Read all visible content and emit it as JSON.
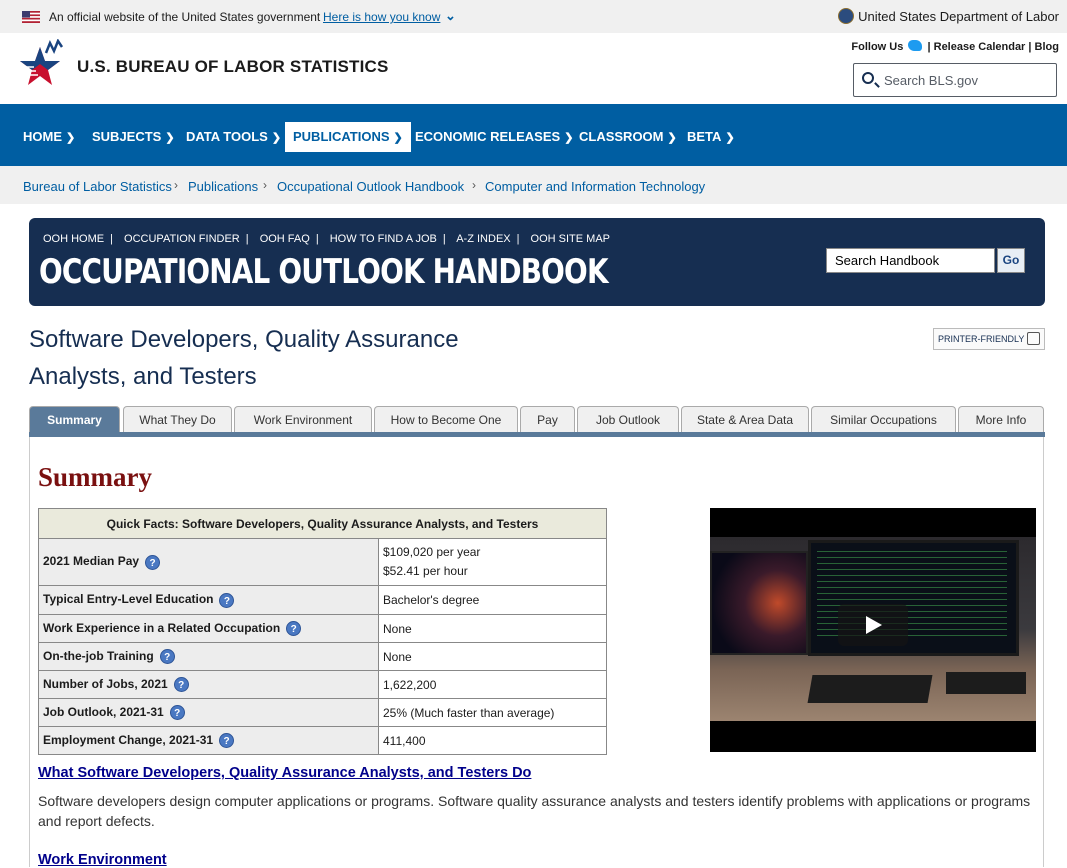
{
  "govbar": {
    "official_text": "An official website of the United States government",
    "how_link": "Here is how you know",
    "dol": "United States Department of Labor"
  },
  "header": {
    "agency": "U.S. BUREAU OF LABOR STATISTICS",
    "follow_us": "Follow Us",
    "release_calendar": "Release Calendar",
    "blog": "Blog",
    "search_placeholder": "Search BLS.gov"
  },
  "nav": {
    "items": [
      {
        "label": "HOME"
      },
      {
        "label": "SUBJECTS"
      },
      {
        "label": "DATA TOOLS"
      },
      {
        "label": "PUBLICATIONS"
      },
      {
        "label": "ECONOMIC RELEASES"
      },
      {
        "label": "CLASSROOM"
      },
      {
        "label": "BETA"
      }
    ],
    "active": "PUBLICATIONS"
  },
  "breadcrumb": [
    "Bureau of Labor Statistics",
    "Publications",
    "Occupational Outlook Handbook",
    "Computer and Information Technology"
  ],
  "ooh": {
    "links": [
      "OOH HOME",
      "OCCUPATION FINDER",
      "OOH FAQ",
      "HOW TO FIND A JOB",
      "A-Z INDEX",
      "OOH SITE MAP"
    ],
    "title": "OCCUPATIONAL OUTLOOK HANDBOOK",
    "search_value": "Search Handbook",
    "go": "Go"
  },
  "page": {
    "title": "Software Developers, Quality Assurance Analysts, and Testers",
    "printer": "PRINTER-FRIENDLY"
  },
  "tabs": [
    "Summary",
    "What They Do",
    "Work Environment",
    "How to Become One",
    "Pay",
    "Job Outlook",
    "State & Area Data",
    "Similar Occupations",
    "More Info"
  ],
  "active_tab": "Summary",
  "summary": {
    "heading": "Summary",
    "table_title": "Quick Facts: Software Developers, Quality Assurance Analysts, and Testers",
    "rows": [
      {
        "label": "2021 Median Pay",
        "value": "$109,020 per year",
        "value2": "$52.41 per hour"
      },
      {
        "label": "Typical Entry-Level Education",
        "value": "Bachelor's degree"
      },
      {
        "label": "Work Experience in a Related Occupation",
        "value": "None"
      },
      {
        "label": "On-the-job Training",
        "value": "None"
      },
      {
        "label": "Number of Jobs, 2021",
        "value": "1,622,200"
      },
      {
        "label": "Job Outlook, 2021-31",
        "value": "25% (Much faster than average)"
      },
      {
        "label": "Employment Change, 2021-31",
        "value": "411,400"
      }
    ],
    "link_what": "What Software Developers, Quality Assurance Analysts, and Testers Do",
    "what_text": "Software developers design computer applications or programs. Software quality assurance analysts and testers identify problems with applications or programs and report defects.",
    "link_env": "Work Environment"
  }
}
